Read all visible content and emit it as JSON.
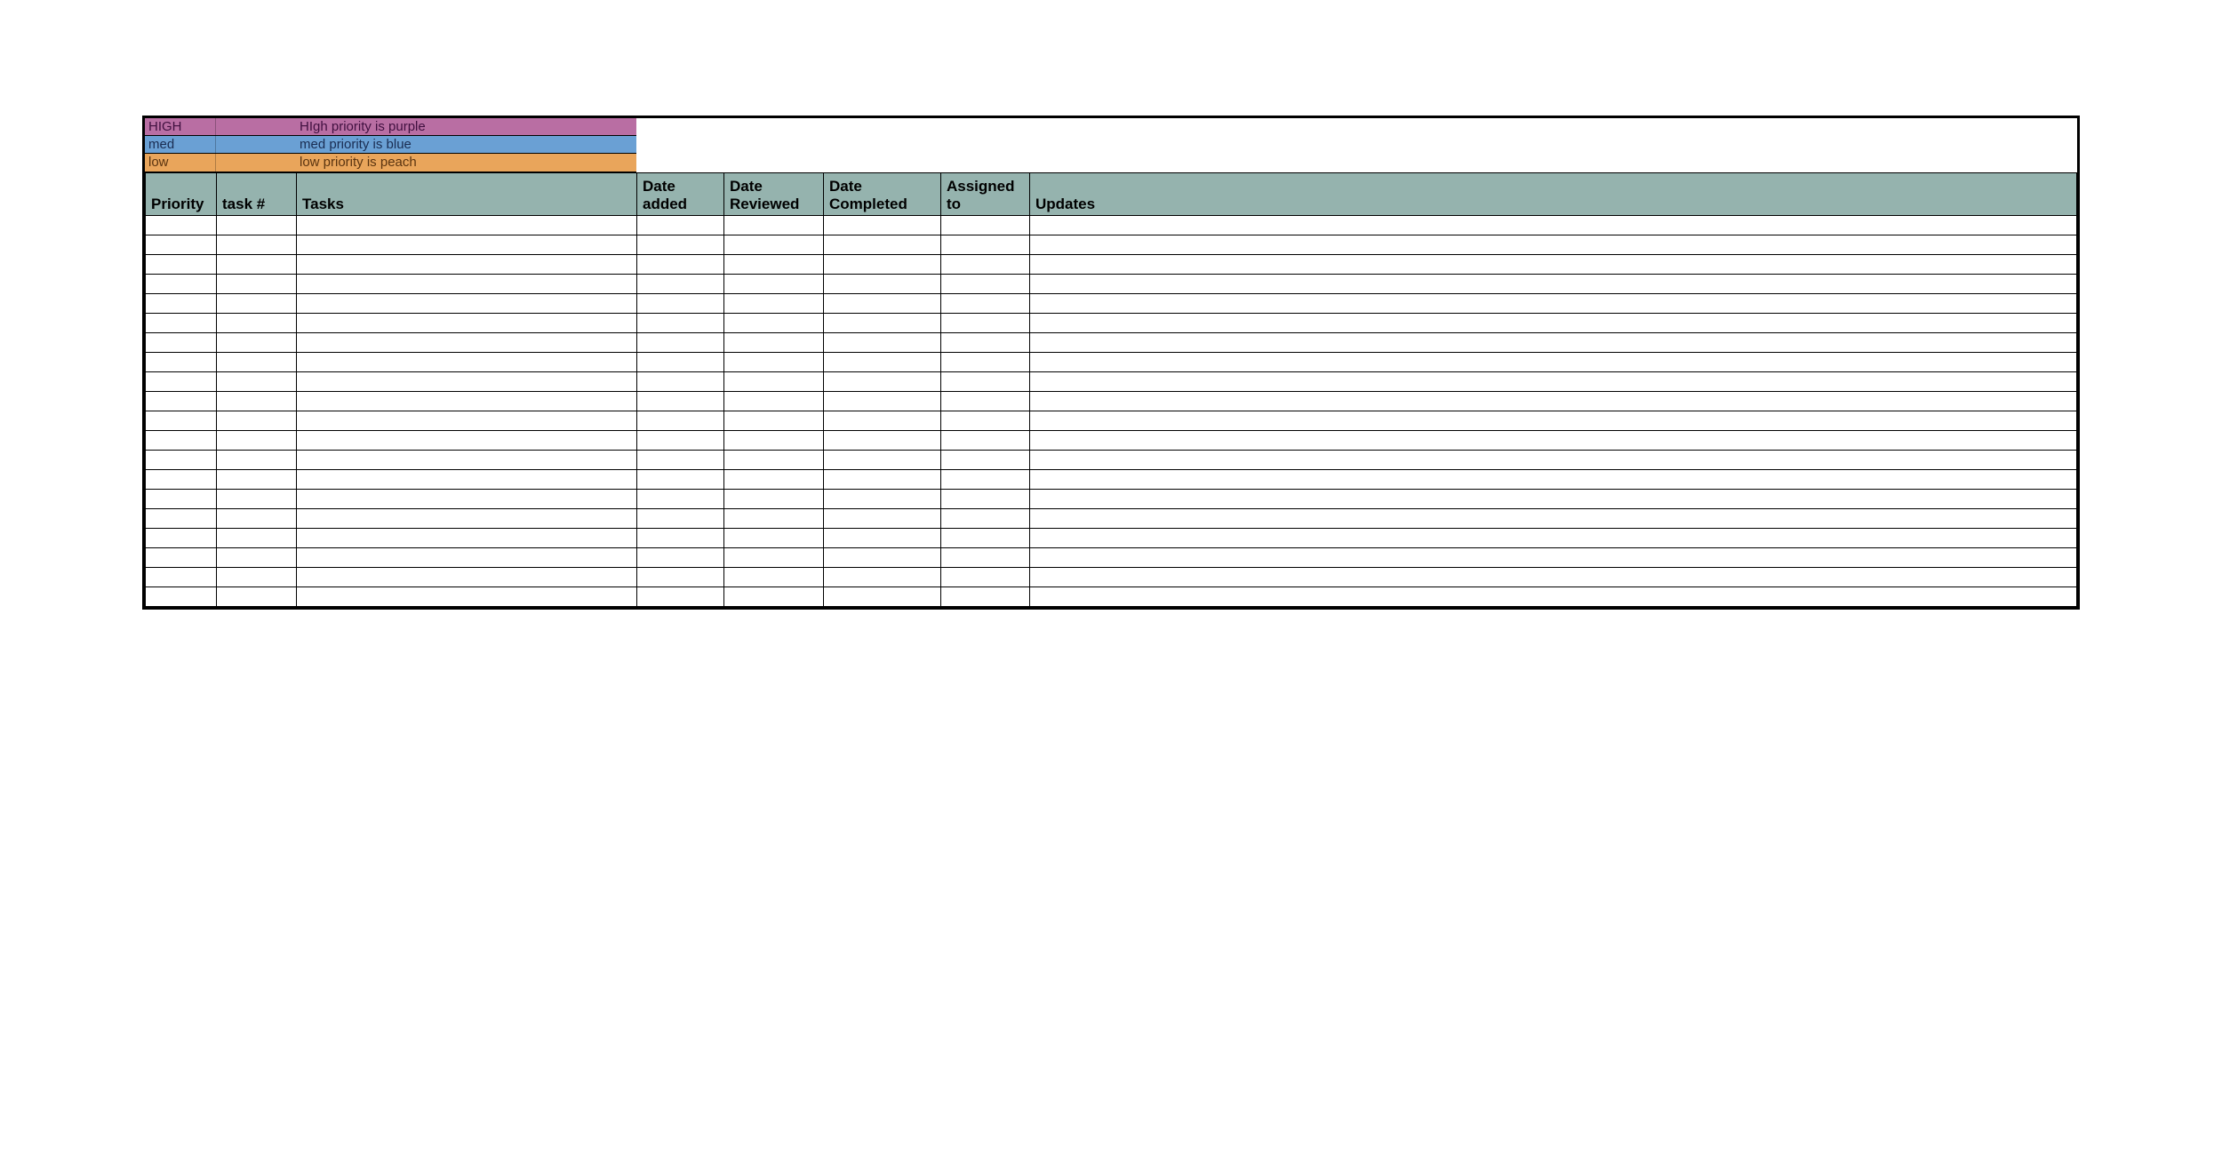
{
  "legend": [
    {
      "label": "HIGH",
      "desc": "HIgh priority is purple",
      "color": "purple"
    },
    {
      "label": "med",
      "desc": "med priority is blue",
      "color": "blue"
    },
    {
      "label": "low",
      "desc": "low priority is peach",
      "color": "peach"
    }
  ],
  "columns": {
    "priority": "Priority",
    "tasknum": "task #",
    "tasks": "Tasks",
    "dateadded": "Date added",
    "datereviewed": "Date Reviewed",
    "datecompleted": "Date Completed",
    "assignedto": "Assigned to",
    "updates": "Updates"
  },
  "rows": [
    {
      "priority": "",
      "tasknum": "",
      "tasks": "",
      "dateadded": "",
      "datereviewed": "",
      "datecompleted": "",
      "assignedto": "",
      "updates": ""
    },
    {
      "priority": "",
      "tasknum": "",
      "tasks": "",
      "dateadded": "",
      "datereviewed": "",
      "datecompleted": "",
      "assignedto": "",
      "updates": ""
    },
    {
      "priority": "",
      "tasknum": "",
      "tasks": "",
      "dateadded": "",
      "datereviewed": "",
      "datecompleted": "",
      "assignedto": "",
      "updates": ""
    },
    {
      "priority": "",
      "tasknum": "",
      "tasks": "",
      "dateadded": "",
      "datereviewed": "",
      "datecompleted": "",
      "assignedto": "",
      "updates": ""
    },
    {
      "priority": "",
      "tasknum": "",
      "tasks": "",
      "dateadded": "",
      "datereviewed": "",
      "datecompleted": "",
      "assignedto": "",
      "updates": ""
    },
    {
      "priority": "",
      "tasknum": "",
      "tasks": "",
      "dateadded": "",
      "datereviewed": "",
      "datecompleted": "",
      "assignedto": "",
      "updates": ""
    },
    {
      "priority": "",
      "tasknum": "",
      "tasks": "",
      "dateadded": "",
      "datereviewed": "",
      "datecompleted": "",
      "assignedto": "",
      "updates": ""
    },
    {
      "priority": "",
      "tasknum": "",
      "tasks": "",
      "dateadded": "",
      "datereviewed": "",
      "datecompleted": "",
      "assignedto": "",
      "updates": ""
    },
    {
      "priority": "",
      "tasknum": "",
      "tasks": "",
      "dateadded": "",
      "datereviewed": "",
      "datecompleted": "",
      "assignedto": "",
      "updates": ""
    },
    {
      "priority": "",
      "tasknum": "",
      "tasks": "",
      "dateadded": "",
      "datereviewed": "",
      "datecompleted": "",
      "assignedto": "",
      "updates": ""
    },
    {
      "priority": "",
      "tasknum": "",
      "tasks": "",
      "dateadded": "",
      "datereviewed": "",
      "datecompleted": "",
      "assignedto": "",
      "updates": ""
    },
    {
      "priority": "",
      "tasknum": "",
      "tasks": "",
      "dateadded": "",
      "datereviewed": "",
      "datecompleted": "",
      "assignedto": "",
      "updates": ""
    },
    {
      "priority": "",
      "tasknum": "",
      "tasks": "",
      "dateadded": "",
      "datereviewed": "",
      "datecompleted": "",
      "assignedto": "",
      "updates": ""
    },
    {
      "priority": "",
      "tasknum": "",
      "tasks": "",
      "dateadded": "",
      "datereviewed": "",
      "datecompleted": "",
      "assignedto": "",
      "updates": ""
    },
    {
      "priority": "",
      "tasknum": "",
      "tasks": "",
      "dateadded": "",
      "datereviewed": "",
      "datecompleted": "",
      "assignedto": "",
      "updates": ""
    },
    {
      "priority": "",
      "tasknum": "",
      "tasks": "",
      "dateadded": "",
      "datereviewed": "",
      "datecompleted": "",
      "assignedto": "",
      "updates": ""
    },
    {
      "priority": "",
      "tasknum": "",
      "tasks": "",
      "dateadded": "",
      "datereviewed": "",
      "datecompleted": "",
      "assignedto": "",
      "updates": ""
    },
    {
      "priority": "",
      "tasknum": "",
      "tasks": "",
      "dateadded": "",
      "datereviewed": "",
      "datecompleted": "",
      "assignedto": "",
      "updates": ""
    },
    {
      "priority": "",
      "tasknum": "",
      "tasks": "",
      "dateadded": "",
      "datereviewed": "",
      "datecompleted": "",
      "assignedto": "",
      "updates": ""
    },
    {
      "priority": "",
      "tasknum": "",
      "tasks": "",
      "dateadded": "",
      "datereviewed": "",
      "datecompleted": "",
      "assignedto": "",
      "updates": ""
    }
  ]
}
